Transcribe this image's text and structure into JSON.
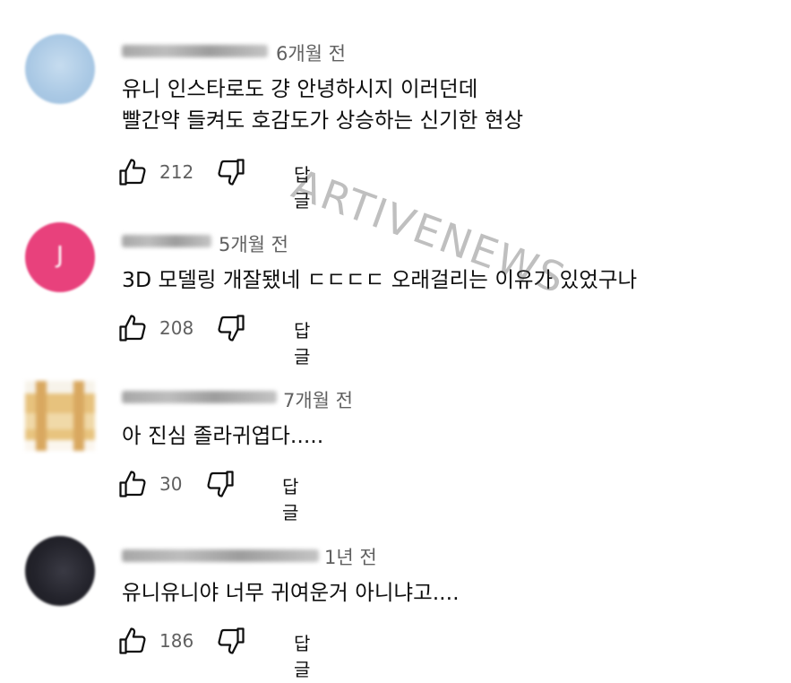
{
  "watermark": "ARTIVENEWS",
  "comments": [
    {
      "avatar_letter": "",
      "time": "6개월 전",
      "lines": [
        "유니 인스타로도 걍 안녕하시지 이러던데",
        "빨간약 들켜도 호감도가 상승하는 신기한 현상"
      ],
      "likes": "212",
      "reply": "답글"
    },
    {
      "avatar_letter": "J",
      "time": "5개월 전",
      "lines": [
        "3D 모델링 개잘됐네 ㄷㄷㄷㄷ 오래걸리는 이유가 있었구나"
      ],
      "likes": "208",
      "reply": "답글"
    },
    {
      "avatar_letter": "",
      "time": "7개월 전",
      "lines": [
        "아 진심 졸라귀엽다....."
      ],
      "likes": "30",
      "reply": "답글"
    },
    {
      "avatar_letter": "",
      "time": "1년 전",
      "lines": [
        "유니유니야 너무 귀여운거 아니냐고...."
      ],
      "likes": "186",
      "reply": "답글"
    }
  ],
  "icons": {
    "like": "thumbs-up-icon",
    "dislike": "thumbs-down-icon"
  },
  "colors": {
    "text": "#0f0f0f",
    "secondary": "#606060",
    "avatar_pink": "#e8417c"
  }
}
